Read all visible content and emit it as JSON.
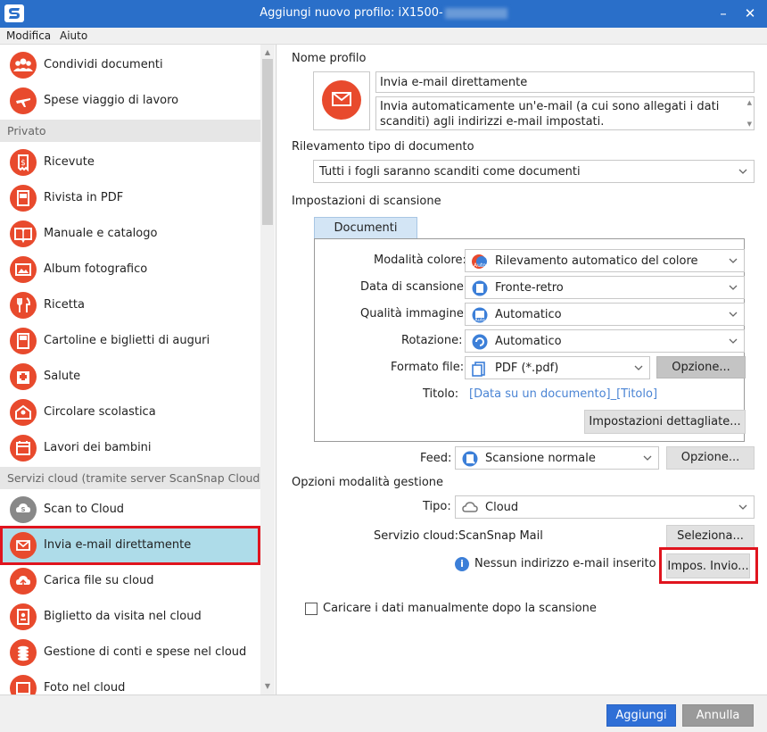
{
  "window": {
    "title": "Aggiungi nuovo profilo: iX1500-",
    "min_glyph": "–",
    "close_glyph": "✕"
  },
  "menu": {
    "items": [
      "Modifica",
      "Aiuto"
    ]
  },
  "sidebar": {
    "items_top": [
      {
        "label": "Condividi documenti",
        "icon": "people-icon"
      },
      {
        "label": "Spese viaggio di lavoro",
        "icon": "airplane-icon"
      }
    ],
    "section_private": "Privato",
    "items_private": [
      {
        "label": "Ricevute",
        "icon": "receipt-icon"
      },
      {
        "label": "Rivista in PDF",
        "icon": "magazine-icon"
      },
      {
        "label": "Manuale e catalogo",
        "icon": "book-icon"
      },
      {
        "label": "Album fotografico",
        "icon": "photo-album-icon"
      },
      {
        "label": "Ricetta",
        "icon": "cutlery-icon"
      },
      {
        "label": "Cartoline e biglietti di auguri",
        "icon": "postcard-icon"
      },
      {
        "label": "Salute",
        "icon": "hospital-icon"
      },
      {
        "label": "Circolare scolastica",
        "icon": "school-icon"
      },
      {
        "label": "Lavori dei bambini",
        "icon": "calendar-icon"
      }
    ],
    "section_cloud": "Servizi cloud (tramite server ScanSnap Cloud)",
    "items_cloud": [
      {
        "label": "Scan to Cloud",
        "icon": "scan-to-cloud-icon"
      },
      {
        "label": "Invia e-mail direttamente",
        "icon": "envelope-icon",
        "selected": true
      },
      {
        "label": "Carica file su cloud",
        "icon": "cloud-upload-icon"
      },
      {
        "label": "Biglietto da visita nel cloud",
        "icon": "business-card-icon"
      },
      {
        "label": "Gestione di conti e spese nel cloud",
        "icon": "coins-icon"
      },
      {
        "label": "Foto nel cloud",
        "icon": "photo-icon"
      }
    ]
  },
  "profile": {
    "name_label": "Nome profilo",
    "name_value": "Invia e-mail direttamente",
    "description": "Invia automaticamente un'e-mail (a cui sono allegati i dati scanditi) agli indirizzi e-mail impostati."
  },
  "detection": {
    "label": "Rilevamento tipo di documento",
    "value": "Tutti i fogli saranno scanditi come documenti"
  },
  "scan_settings": {
    "label": "Impostazioni di scansione",
    "tab": "Documenti",
    "rows": [
      {
        "label": "Modalità colore:",
        "value": "Rilevamento automatico del colore",
        "icon": "auto-color-icon"
      },
      {
        "label": "Data di scansione:",
        "value": "Fronte-retro",
        "icon": "duplex-icon"
      },
      {
        "label": "Qualità immagine:",
        "value": "Automatico",
        "icon": "auto-quality-icon"
      },
      {
        "label": "Rotazione:",
        "value": "Automatico",
        "icon": "rotation-icon"
      }
    ],
    "format_label": "Formato file:",
    "format_value": "PDF (*.pdf)",
    "format_option_button": "Opzione...",
    "title_label": "Titolo:",
    "title_value": "[Data su un documento]_[Titolo]",
    "detailed_button": "Impostazioni dettagliate..."
  },
  "feed": {
    "label": "Feed:",
    "value": "Scansione normale",
    "option_button": "Opzione..."
  },
  "management": {
    "label": "Opzioni modalità gestione",
    "type_label": "Tipo:",
    "type_value": "Cloud",
    "service_label": "Servizio cloud:",
    "service_value": "ScanSnap Mail",
    "select_button": "Seleziona...",
    "info_text": "Nessun indirizzo e-mail inserito",
    "send_button": "Impos. Invio..."
  },
  "manual_upload_checkbox": "Caricare i dati manualmente dopo la scansione",
  "footer": {
    "add": "Aggiungi",
    "cancel": "Annulla"
  },
  "colors": {
    "accent": "#e84a2d",
    "titlebar": "#2a6fc9",
    "highlight": "#e0141e",
    "primary_button": "#2f6fd6"
  }
}
